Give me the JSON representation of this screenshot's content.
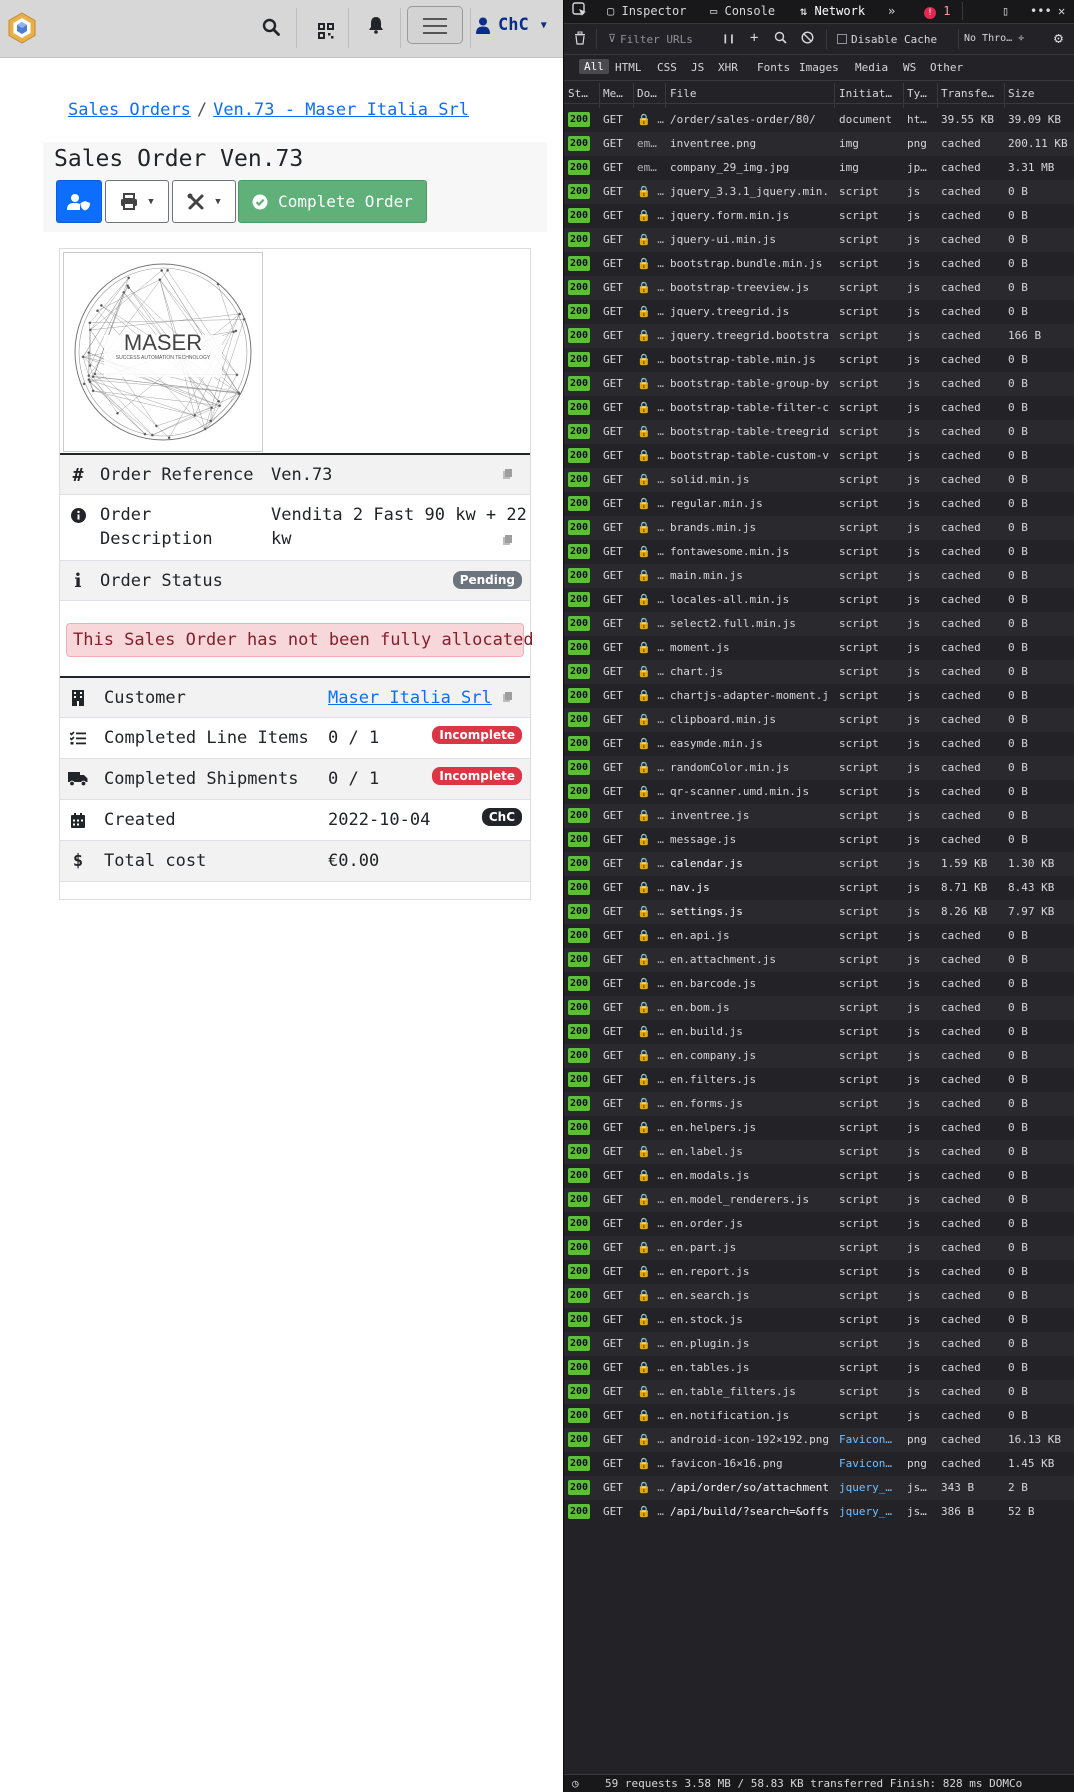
{
  "topnav": {
    "user_label": "ChC",
    "icons": [
      "search-icon",
      "qrcode-icon",
      "bell-icon",
      "menu-icon",
      "user-icon"
    ]
  },
  "breadcrumbs": [
    {
      "label": "Sales Orders"
    },
    {
      "label": "Ven.73 - Maser Italia Srl"
    }
  ],
  "breadcrumb_sep": "/",
  "page": {
    "title": "Sales Order Ven.73",
    "complete_button": "Complete Order"
  },
  "company_logo": {
    "brand": "MASER",
    "tagline": "SUCCESS AUTOMATION TECHNOLOGY"
  },
  "order": {
    "ref_label": "Order Reference",
    "ref_value": "Ven.73",
    "desc_label_1": "Order",
    "desc_label_2": "Description",
    "desc_value_1": "Vendita 2 Fast 90 kw + 22",
    "desc_value_2": "kw",
    "status_label": "Order Status",
    "status_badge": "Pending",
    "alert": "This Sales Order has not been fully allocated",
    "customer_label": "Customer",
    "customer_value": "Maser Italia Srl",
    "lines_label": "Completed Line Items",
    "lines_value": "0 / 1",
    "lines_badge": "Incomplete",
    "shipments_label": "Completed Shipments",
    "shipments_value": "0 / 1",
    "shipments_badge": "Incomplete",
    "created_label": "Created",
    "created_value": "2022-10-04",
    "created_badge": "ChC",
    "cost_label": "Total cost",
    "cost_value": "€0.00"
  },
  "devtools": {
    "tabs": {
      "inspector": "Inspector",
      "console": "Console",
      "network": "Network",
      "errors": "1"
    },
    "filter_placeholder": "Filter URLs",
    "disable_cache": "Disable Cache",
    "throttle": "No Thro… ÷",
    "type_filters": [
      "All",
      "HTML",
      "CSS",
      "JS",
      "XHR",
      "Fonts",
      "Images",
      "Media",
      "WS",
      "Other"
    ],
    "columns": [
      "St…",
      "Me…",
      "Do…",
      "File",
      "Initiat…",
      "Ty…",
      "Transfe…",
      "Size"
    ],
    "requests": [
      {
        "status": "200",
        "method": "GET",
        "domain": "🔒 …",
        "file": "/order/sales-order/80/",
        "initiator": "document",
        "type": "ht…",
        "transferred": "39.55 KB",
        "size": "39.09 KB"
      },
      {
        "status": "200",
        "method": "GET",
        "domain": "em…",
        "file": "inventree.png",
        "initiator": "img",
        "type": "png",
        "transferred": "cached",
        "size": "200.11 KB"
      },
      {
        "status": "200",
        "method": "GET",
        "domain": "em…",
        "file": "company_29_img.jpg",
        "initiator": "img",
        "type": "jp…",
        "transferred": "cached",
        "size": "3.31 MB"
      },
      {
        "status": "200",
        "method": "GET",
        "domain": "🔒 …",
        "file": "jquery_3.3.1_jquery.min.",
        "initiator": "script",
        "type": "js",
        "transferred": "cached",
        "size": "0 B"
      },
      {
        "status": "200",
        "method": "GET",
        "domain": "🔒 …",
        "file": "jquery.form.min.js",
        "initiator": "script",
        "type": "js",
        "transferred": "cached",
        "size": "0 B"
      },
      {
        "status": "200",
        "method": "GET",
        "domain": "🔒 …",
        "file": "jquery-ui.min.js",
        "initiator": "script",
        "type": "js",
        "transferred": "cached",
        "size": "0 B"
      },
      {
        "status": "200",
        "method": "GET",
        "domain": "🔒 …",
        "file": "bootstrap.bundle.min.js",
        "initiator": "script",
        "type": "js",
        "transferred": "cached",
        "size": "0 B"
      },
      {
        "status": "200",
        "method": "GET",
        "domain": "🔒 …",
        "file": "bootstrap-treeview.js",
        "initiator": "script",
        "type": "js",
        "transferred": "cached",
        "size": "0 B"
      },
      {
        "status": "200",
        "method": "GET",
        "domain": "🔒 …",
        "file": "jquery.treegrid.js",
        "initiator": "script",
        "type": "js",
        "transferred": "cached",
        "size": "0 B"
      },
      {
        "status": "200",
        "method": "GET",
        "domain": "🔒 …",
        "file": "jquery.treegrid.bootstra",
        "initiator": "script",
        "type": "js",
        "transferred": "cached",
        "size": "166 B"
      },
      {
        "status": "200",
        "method": "GET",
        "domain": "🔒 …",
        "file": "bootstrap-table.min.js",
        "initiator": "script",
        "type": "js",
        "transferred": "cached",
        "size": "0 B"
      },
      {
        "status": "200",
        "method": "GET",
        "domain": "🔒 …",
        "file": "bootstrap-table-group-by",
        "initiator": "script",
        "type": "js",
        "transferred": "cached",
        "size": "0 B"
      },
      {
        "status": "200",
        "method": "GET",
        "domain": "🔒 …",
        "file": "bootstrap-table-filter-c",
        "initiator": "script",
        "type": "js",
        "transferred": "cached",
        "size": "0 B"
      },
      {
        "status": "200",
        "method": "GET",
        "domain": "🔒 …",
        "file": "bootstrap-table-treegrid",
        "initiator": "script",
        "type": "js",
        "transferred": "cached",
        "size": "0 B"
      },
      {
        "status": "200",
        "method": "GET",
        "domain": "🔒 …",
        "file": "bootstrap-table-custom-v",
        "initiator": "script",
        "type": "js",
        "transferred": "cached",
        "size": "0 B"
      },
      {
        "status": "200",
        "method": "GET",
        "domain": "🔒 …",
        "file": "solid.min.js",
        "initiator": "script",
        "type": "js",
        "transferred": "cached",
        "size": "0 B"
      },
      {
        "status": "200",
        "method": "GET",
        "domain": "🔒 …",
        "file": "regular.min.js",
        "initiator": "script",
        "type": "js",
        "transferred": "cached",
        "size": "0 B"
      },
      {
        "status": "200",
        "method": "GET",
        "domain": "🔒 …",
        "file": "brands.min.js",
        "initiator": "script",
        "type": "js",
        "transferred": "cached",
        "size": "0 B"
      },
      {
        "status": "200",
        "method": "GET",
        "domain": "🔒 …",
        "file": "fontawesome.min.js",
        "initiator": "script",
        "type": "js",
        "transferred": "cached",
        "size": "0 B"
      },
      {
        "status": "200",
        "method": "GET",
        "domain": "🔒 …",
        "file": "main.min.js",
        "initiator": "script",
        "type": "js",
        "transferred": "cached",
        "size": "0 B"
      },
      {
        "status": "200",
        "method": "GET",
        "domain": "🔒 …",
        "file": "locales-all.min.js",
        "initiator": "script",
        "type": "js",
        "transferred": "cached",
        "size": "0 B"
      },
      {
        "status": "200",
        "method": "GET",
        "domain": "🔒 …",
        "file": "select2.full.min.js",
        "initiator": "script",
        "type": "js",
        "transferred": "cached",
        "size": "0 B"
      },
      {
        "status": "200",
        "method": "GET",
        "domain": "🔒 …",
        "file": "moment.js",
        "initiator": "script",
        "type": "js",
        "transferred": "cached",
        "size": "0 B"
      },
      {
        "status": "200",
        "method": "GET",
        "domain": "🔒 …",
        "file": "chart.js",
        "initiator": "script",
        "type": "js",
        "transferred": "cached",
        "size": "0 B"
      },
      {
        "status": "200",
        "method": "GET",
        "domain": "🔒 …",
        "file": "chartjs-adapter-moment.j",
        "initiator": "script",
        "type": "js",
        "transferred": "cached",
        "size": "0 B"
      },
      {
        "status": "200",
        "method": "GET",
        "domain": "🔒 …",
        "file": "clipboard.min.js",
        "initiator": "script",
        "type": "js",
        "transferred": "cached",
        "size": "0 B"
      },
      {
        "status": "200",
        "method": "GET",
        "domain": "🔒 …",
        "file": "easymde.min.js",
        "initiator": "script",
        "type": "js",
        "transferred": "cached",
        "size": "0 B"
      },
      {
        "status": "200",
        "method": "GET",
        "domain": "🔒 …",
        "file": "randomColor.min.js",
        "initiator": "script",
        "type": "js",
        "transferred": "cached",
        "size": "0 B"
      },
      {
        "status": "200",
        "method": "GET",
        "domain": "🔒 …",
        "file": "qr-scanner.umd.min.js",
        "initiator": "script",
        "type": "js",
        "transferred": "cached",
        "size": "0 B"
      },
      {
        "status": "200",
        "method": "GET",
        "domain": "🔒 …",
        "file": "inventree.js",
        "initiator": "script",
        "type": "js",
        "transferred": "cached",
        "size": "0 B"
      },
      {
        "status": "200",
        "method": "GET",
        "domain": "🔒 …",
        "file": "message.js",
        "initiator": "script",
        "type": "js",
        "transferred": "cached",
        "size": "0 B"
      },
      {
        "status": "200",
        "method": "GET",
        "domain": "🔒 …",
        "file": "calendar.js",
        "initiator": "script",
        "type": "js",
        "transferred": "1.59 KB",
        "size": "1.30 KB",
        "bright": true
      },
      {
        "status": "200",
        "method": "GET",
        "domain": "🔒 …",
        "file": "nav.js",
        "initiator": "script",
        "type": "js",
        "transferred": "8.71 KB",
        "size": "8.43 KB",
        "bright": true
      },
      {
        "status": "200",
        "method": "GET",
        "domain": "🔒 …",
        "file": "settings.js",
        "initiator": "script",
        "type": "js",
        "transferred": "8.26 KB",
        "size": "7.97 KB",
        "bright": true
      },
      {
        "status": "200",
        "method": "GET",
        "domain": "🔒 …",
        "file": "en.api.js",
        "initiator": "script",
        "type": "js",
        "transferred": "cached",
        "size": "0 B"
      },
      {
        "status": "200",
        "method": "GET",
        "domain": "🔒 …",
        "file": "en.attachment.js",
        "initiator": "script",
        "type": "js",
        "transferred": "cached",
        "size": "0 B"
      },
      {
        "status": "200",
        "method": "GET",
        "domain": "🔒 …",
        "file": "en.barcode.js",
        "initiator": "script",
        "type": "js",
        "transferred": "cached",
        "size": "0 B"
      },
      {
        "status": "200",
        "method": "GET",
        "domain": "🔒 …",
        "file": "en.bom.js",
        "initiator": "script",
        "type": "js",
        "transferred": "cached",
        "size": "0 B"
      },
      {
        "status": "200",
        "method": "GET",
        "domain": "🔒 …",
        "file": "en.build.js",
        "initiator": "script",
        "type": "js",
        "transferred": "cached",
        "size": "0 B"
      },
      {
        "status": "200",
        "method": "GET",
        "domain": "🔒 …",
        "file": "en.company.js",
        "initiator": "script",
        "type": "js",
        "transferred": "cached",
        "size": "0 B"
      },
      {
        "status": "200",
        "method": "GET",
        "domain": "🔒 …",
        "file": "en.filters.js",
        "initiator": "script",
        "type": "js",
        "transferred": "cached",
        "size": "0 B"
      },
      {
        "status": "200",
        "method": "GET",
        "domain": "🔒 …",
        "file": "en.forms.js",
        "initiator": "script",
        "type": "js",
        "transferred": "cached",
        "size": "0 B"
      },
      {
        "status": "200",
        "method": "GET",
        "domain": "🔒 …",
        "file": "en.helpers.js",
        "initiator": "script",
        "type": "js",
        "transferred": "cached",
        "size": "0 B"
      },
      {
        "status": "200",
        "method": "GET",
        "domain": "🔒 …",
        "file": "en.label.js",
        "initiator": "script",
        "type": "js",
        "transferred": "cached",
        "size": "0 B"
      },
      {
        "status": "200",
        "method": "GET",
        "domain": "🔒 …",
        "file": "en.modals.js",
        "initiator": "script",
        "type": "js",
        "transferred": "cached",
        "size": "0 B"
      },
      {
        "status": "200",
        "method": "GET",
        "domain": "🔒 …",
        "file": "en.model_renderers.js",
        "initiator": "script",
        "type": "js",
        "transferred": "cached",
        "size": "0 B"
      },
      {
        "status": "200",
        "method": "GET",
        "domain": "🔒 …",
        "file": "en.order.js",
        "initiator": "script",
        "type": "js",
        "transferred": "cached",
        "size": "0 B"
      },
      {
        "status": "200",
        "method": "GET",
        "domain": "🔒 …",
        "file": "en.part.js",
        "initiator": "script",
        "type": "js",
        "transferred": "cached",
        "size": "0 B"
      },
      {
        "status": "200",
        "method": "GET",
        "domain": "🔒 …",
        "file": "en.report.js",
        "initiator": "script",
        "type": "js",
        "transferred": "cached",
        "size": "0 B"
      },
      {
        "status": "200",
        "method": "GET",
        "domain": "🔒 …",
        "file": "en.search.js",
        "initiator": "script",
        "type": "js",
        "transferred": "cached",
        "size": "0 B"
      },
      {
        "status": "200",
        "method": "GET",
        "domain": "🔒 …",
        "file": "en.stock.js",
        "initiator": "script",
        "type": "js",
        "transferred": "cached",
        "size": "0 B"
      },
      {
        "status": "200",
        "method": "GET",
        "domain": "🔒 …",
        "file": "en.plugin.js",
        "initiator": "script",
        "type": "js",
        "transferred": "cached",
        "size": "0 B"
      },
      {
        "status": "200",
        "method": "GET",
        "domain": "🔒 …",
        "file": "en.tables.js",
        "initiator": "script",
        "type": "js",
        "transferred": "cached",
        "size": "0 B"
      },
      {
        "status": "200",
        "method": "GET",
        "domain": "🔒 …",
        "file": "en.table_filters.js",
        "initiator": "script",
        "type": "js",
        "transferred": "cached",
        "size": "0 B"
      },
      {
        "status": "200",
        "method": "GET",
        "domain": "🔒 …",
        "file": "en.notification.js",
        "initiator": "script",
        "type": "js",
        "transferred": "cached",
        "size": "0 B"
      },
      {
        "status": "200",
        "method": "GET",
        "domain": "🔒 …",
        "file": "android-icon-192×192.png",
        "initiator": "Favicon…",
        "type": "png",
        "transferred": "cached",
        "size": "16.13 KB",
        "link": true
      },
      {
        "status": "200",
        "method": "GET",
        "domain": "🔒 …",
        "file": "favicon-16×16.png",
        "initiator": "Favicon…",
        "type": "png",
        "transferred": "cached",
        "size": "1.45 KB",
        "link": true
      },
      {
        "status": "200",
        "method": "GET",
        "domain": "🔒 …",
        "file": "/api/order/so/attachment",
        "initiator": "jquery_…",
        "type": "js…",
        "transferred": "343 B",
        "size": "2 B",
        "link": true,
        "bright": true
      },
      {
        "status": "200",
        "method": "GET",
        "domain": "🔒 …",
        "file": "/api/build/?search=&offs",
        "initiator": "jquery_…",
        "type": "js…",
        "transferred": "386 B",
        "size": "52 B",
        "link": true,
        "bright": true
      }
    ],
    "status_summary": "59 requests   3.58 MB / 58.83 KB transferred   Finish: 828 ms   DOMCo"
  }
}
